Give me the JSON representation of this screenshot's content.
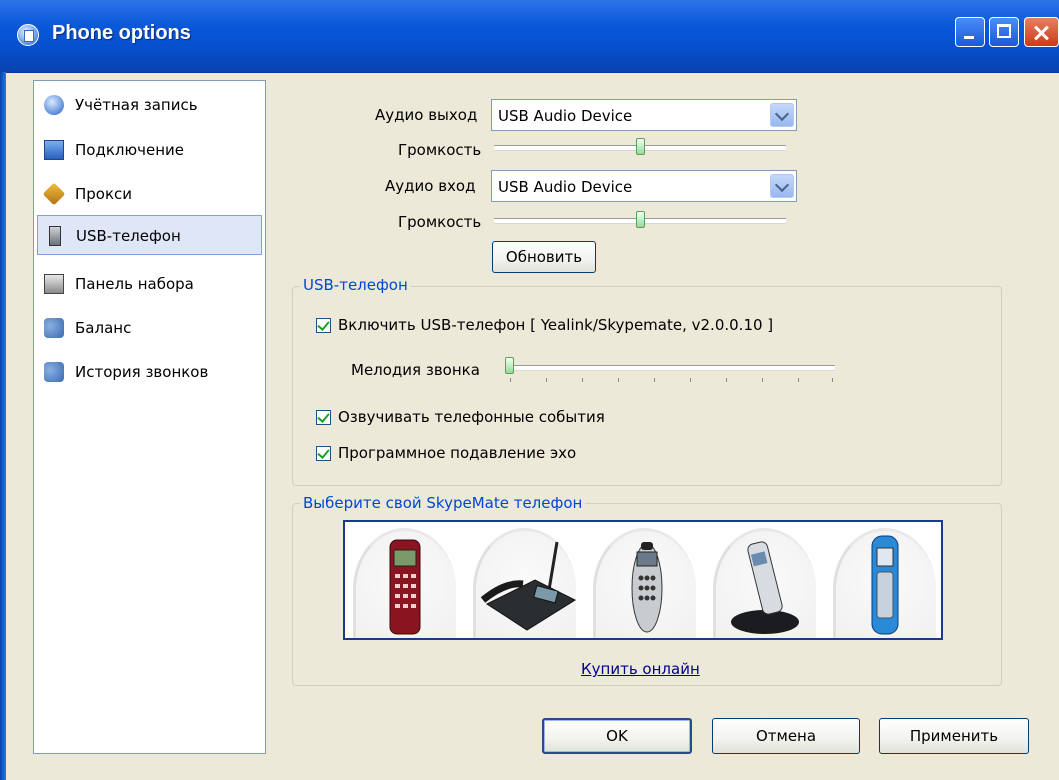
{
  "window": {
    "title": "Phone options"
  },
  "sidebar": {
    "items": [
      {
        "label": "Учётная запись"
      },
      {
        "label": "Подключение"
      },
      {
        "label": "Прокси"
      },
      {
        "label": "USB-телефон"
      },
      {
        "label": "Панель набора"
      },
      {
        "label": "Баланс"
      },
      {
        "label": "История звонков"
      }
    ],
    "selected_index": 3
  },
  "audio": {
    "output_label": "Аудио выход",
    "output_value": "USB Audio Device",
    "volume_label": "Громкость",
    "output_volume_fraction": 0.5,
    "input_label": "Аудио вход",
    "input_value": "USB Audio Device",
    "input_volume_fraction": 0.5,
    "refresh_label": "Обновить"
  },
  "usb_phone": {
    "group_title": "USB-телефон",
    "enable_label": "Включить USB-телефон [ Yealink/Skypemate, v2.0.0.10 ]",
    "enable_checked": true,
    "ringtone_label": "Мелодия звонка",
    "ringtone_fraction": 0.0,
    "announce_label": "Озвучивать телефонные события",
    "announce_checked": true,
    "echo_label": "Программное подавление эхо",
    "echo_checked": true
  },
  "skypemate": {
    "group_title": "Выберите свой SkypeMate телефон",
    "buy_link": "Купить онлайн"
  },
  "footer": {
    "ok": "OK",
    "cancel": "Отмена",
    "apply": "Применить"
  },
  "colors": {
    "titlebar": "#0a58d8",
    "group_title": "#0046d5",
    "dialog_bg": "#ECE9D8",
    "selection": "#dfe6f7"
  }
}
